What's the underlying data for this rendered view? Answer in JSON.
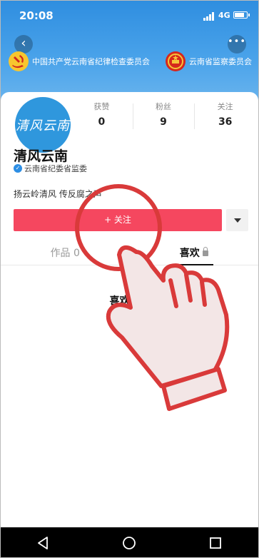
{
  "status": {
    "time": "20:08",
    "network": "4G"
  },
  "header": {
    "org_left": "中国共产党云南省纪律检查委员会",
    "org_right": "云南省监察委员会",
    "more_label": "•••",
    "back_label": "‹"
  },
  "profile": {
    "avatar_text": "清风云南",
    "name": "清风云南",
    "verification": "云南省纪委省监委",
    "bio": "扬云岭清风 传反腐之声",
    "stats": [
      {
        "label": "获赞",
        "value": "0"
      },
      {
        "label": "粉丝",
        "value": "9"
      },
      {
        "label": "关注",
        "value": "36"
      }
    ]
  },
  "actions": {
    "follow_label": "+ 关注"
  },
  "tabs": [
    {
      "label": "作品 0"
    },
    {
      "label": "喜欢"
    }
  ],
  "empty": {
    "title": "喜欢内容",
    "subtitle": "该用户已将"
  },
  "colors": {
    "header_blue": "#2f8ee0",
    "follow_red": "#f5475f",
    "hand_red": "#d93a3a"
  }
}
